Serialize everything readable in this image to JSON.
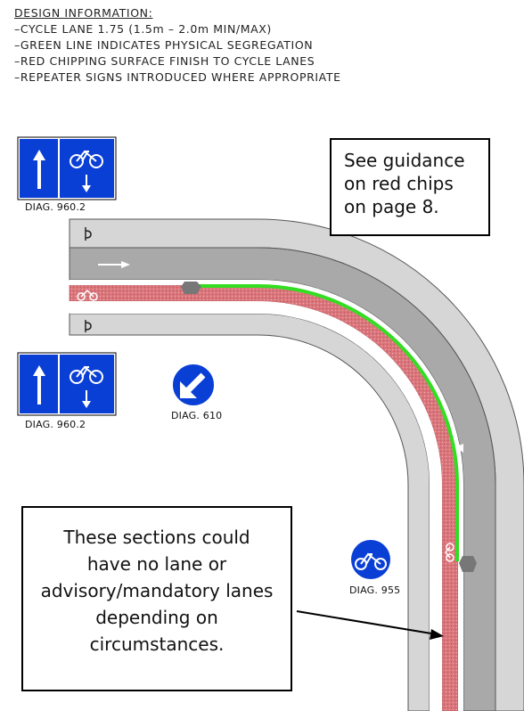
{
  "design_info": {
    "heading": "DESIGN INFORMATION:",
    "lines": [
      "CYCLE LANE 1.75 (1.5m – 2.0m MIN/MAX)",
      "GREEN LINE INDICATES PHYSICAL SEGREGATION",
      "RED CHIPPING SURFACE FINISH TO CYCLE LANES",
      "REPEATER SIGNS INTRODUCED WHERE APPROPRIATE"
    ]
  },
  "callouts": {
    "red_chips": "See guidance on red chips on page 8.",
    "sections": "These sections could have no lane or advisory/mandatory lanes depending on circumstances."
  },
  "signs": {
    "sign_960_top": "DIAG. 960.2",
    "sign_960_bottom": "DIAG. 960.2",
    "sign_610": "DIAG. 610",
    "sign_955": "DIAG. 955"
  },
  "colors": {
    "pavement": "#d6d6d6",
    "carriageway": "#a9a9a9",
    "cycle_lane": "#d9767c",
    "segregation": "#33dd22",
    "sign_blue": "#0a3fd6"
  }
}
